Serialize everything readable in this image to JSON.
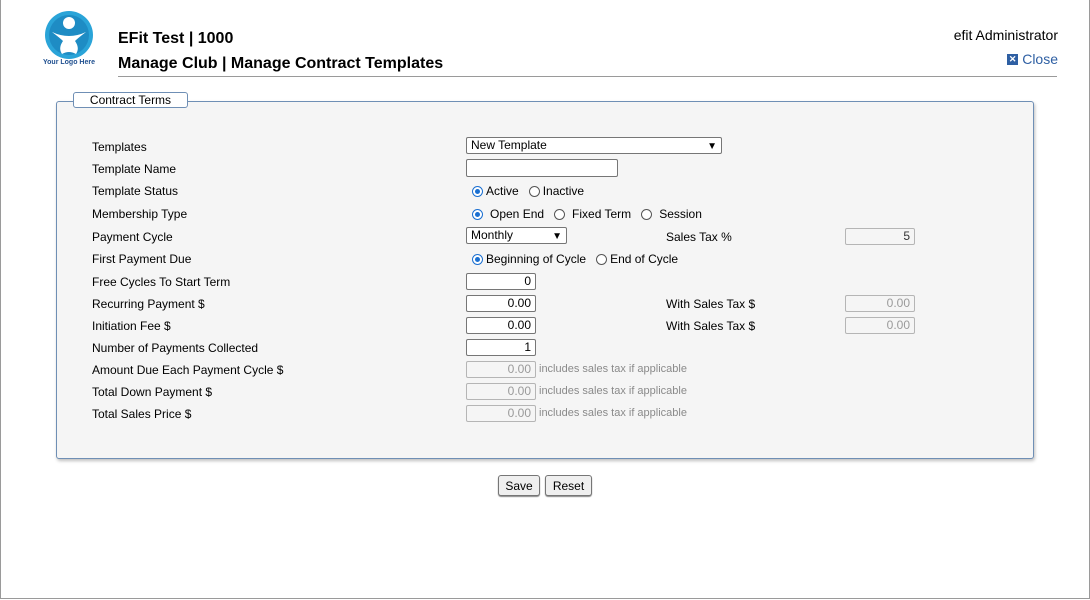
{
  "header": {
    "logo_text": "Your Logo Here",
    "title": "EFit Test | 1000",
    "subtitle": "Manage Club | Manage Contract Templates",
    "user": "efit Administrator",
    "close_label": "Close"
  },
  "panel": {
    "legend": "Contract Terms",
    "labels": {
      "templates": "Templates",
      "template_name": "Template Name",
      "template_status": "Template Status",
      "membership_type": "Membership Type",
      "payment_cycle": "Payment Cycle",
      "first_payment_due": "First Payment Due",
      "free_cycles": "Free Cycles To Start Term",
      "recurring_payment": "Recurring Payment $",
      "initiation_fee": "Initiation Fee $",
      "num_payments": "Number of Payments Collected",
      "amount_due": "Amount Due Each Payment Cycle $",
      "total_down": "Total Down Payment $",
      "total_sales": "Total Sales Price $",
      "sales_tax": "Sales Tax %",
      "with_sales_tax": "With Sales Tax $"
    },
    "templates_selected": "New Template",
    "template_name_value": "",
    "status_options": [
      "Active",
      "Inactive"
    ],
    "membership_options": [
      "Open End",
      "Fixed Term",
      "Session"
    ],
    "payment_cycle_selected": "Monthly",
    "first_payment_options": [
      "Beginning of Cycle",
      "End of Cycle"
    ],
    "values": {
      "sales_tax": "5",
      "free_cycles": "0",
      "recurring_payment": "0.00",
      "recurring_with_tax": "0.00",
      "initiation_fee": "0.00",
      "initiation_with_tax": "0.00",
      "num_payments": "1",
      "amount_due": "0.00",
      "total_down": "0.00",
      "total_sales": "0.00"
    },
    "note": "includes sales tax if applicable"
  },
  "buttons": {
    "save": "Save",
    "reset": "Reset"
  },
  "colors": {
    "accent": "#1a6fd1",
    "link": "#2e5fa3",
    "panel_border": "#6f8fb5"
  }
}
